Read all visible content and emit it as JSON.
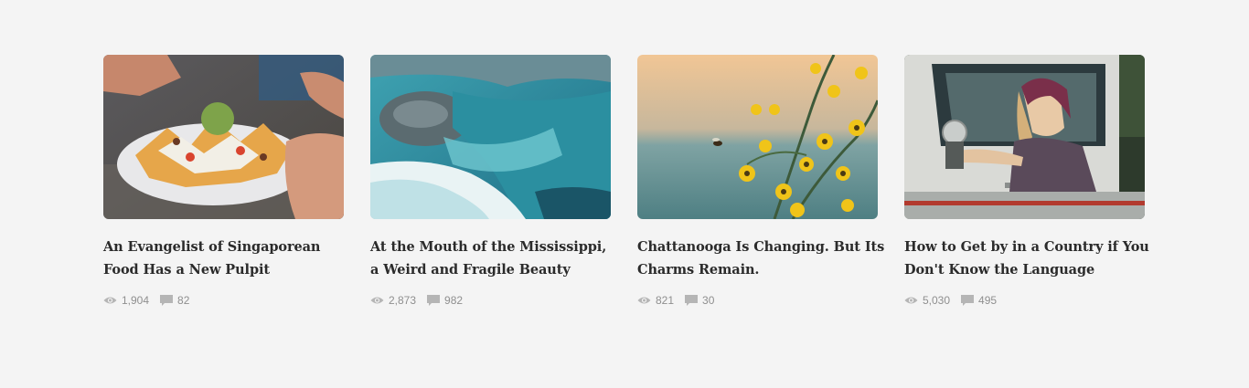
{
  "articles": [
    {
      "title_lines": [
        "An Evangelist of Singaporean",
        "Food Has a New Pulpit"
      ],
      "views": "1,904",
      "comments": "82",
      "image_icon": "nachos-photo"
    },
    {
      "title_lines": [
        "At the Mouth of the Mississippi,",
        "a Weird and Fragile Beauty"
      ],
      "views": "2,873",
      "comments": "982",
      "image_icon": "river-rapids-photo"
    },
    {
      "title_lines": [
        "Chattanooga Is Changing. But Its",
        "Charms Remain."
      ],
      "views": "821",
      "comments": "30",
      "image_icon": "yellow-flowers-photo"
    },
    {
      "title_lines": [
        "How to Get by in a Country if You",
        "Don't Know the Language"
      ],
      "views": "5,030",
      "comments": "495",
      "image_icon": "woman-in-truck-photo"
    }
  ],
  "colors": {
    "background": "#f4f4f4",
    "title": "#2b2b2b",
    "meta": "#8f8f8f",
    "icon": "#b5b5b5"
  }
}
